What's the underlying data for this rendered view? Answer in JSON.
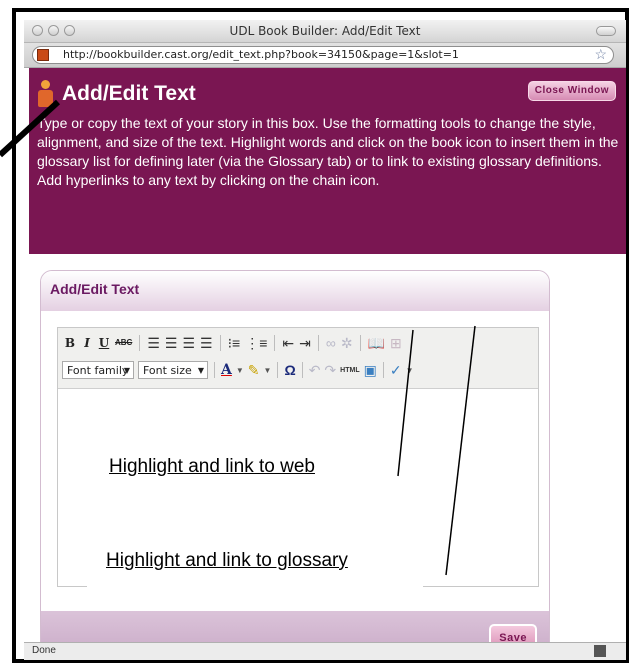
{
  "browser": {
    "window_title": "UDL Book Builder: Add/Edit Text",
    "url": "http://bookbuilder.cast.org/edit_text.php?book=34150&page=1&slot=1",
    "status": "Done"
  },
  "header": {
    "title": "Add/Edit Text",
    "close_label": "Close Window",
    "instructions": "Type or copy the text of your story in this box. Use the formatting tools to change the style, alignment, and size of the text. Highlight words and click on the book icon to insert them in the glossary list for defining later (via the Glossary tab) or to link to existing glossary definitions. Add hyperlinks to any text by clicking on the chain icon."
  },
  "panel": {
    "title": "Add/Edit Text",
    "save_label": "Save"
  },
  "toolbar": {
    "bold": "B",
    "italic": "I",
    "underline": "U",
    "strike": "ABC",
    "font_family": "Font family",
    "font_size": "Font size",
    "html": "HTML"
  },
  "callouts": {
    "web": "Highlight and link to web",
    "glossary": "Highlight and link to glossary"
  },
  "colors": {
    "brand": "#7a1652",
    "panel_title": "#6b1a62",
    "button_fill": "#f4c9de"
  }
}
